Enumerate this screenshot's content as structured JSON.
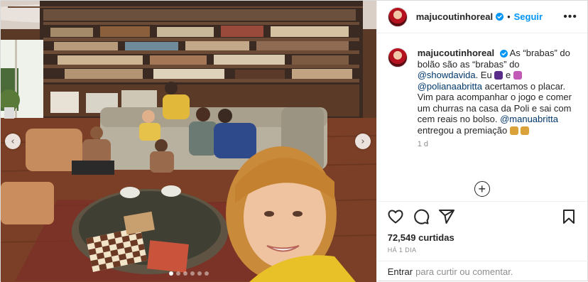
{
  "post": {
    "username": "majucoutinhoreal",
    "separator": "•",
    "follow_label": "Seguir",
    "more_label": "•••",
    "caption": {
      "t1": "As “brabas” do bolão são as “brabas” do",
      "m1": "@showdavida",
      "t2": ". Eu",
      "t3": "e",
      "m2": "@polianaabritta",
      "t4": "acertamos o placar. Vim para acompanhar o jogo e comer um churras na casa da Poli e sai com cem reais no bolso.",
      "m3": "@manuabritta",
      "t5": "entregou a premiação"
    },
    "timestamp": "1 d",
    "load_more_label": "+",
    "likes_count": "72,549",
    "likes_label": "curtidas",
    "age": "HÁ 1 DIA",
    "login_link": "Entrar",
    "login_text": "para curtir ou comentar.",
    "carousel": {
      "prev_label": "‹",
      "next_label": "›",
      "total_slides": 6,
      "active_slide": 1
    }
  },
  "icons": [
    "verified-badge-icon",
    "heart-icon",
    "comment-icon",
    "share-icon",
    "bookmark-icon",
    "add-circle-icon",
    "chevron-left-icon",
    "chevron-right-icon"
  ],
  "colors": {
    "accent": "#0095f6",
    "mention": "#00376b",
    "muted": "#8e8e8e",
    "text": "#262626"
  }
}
